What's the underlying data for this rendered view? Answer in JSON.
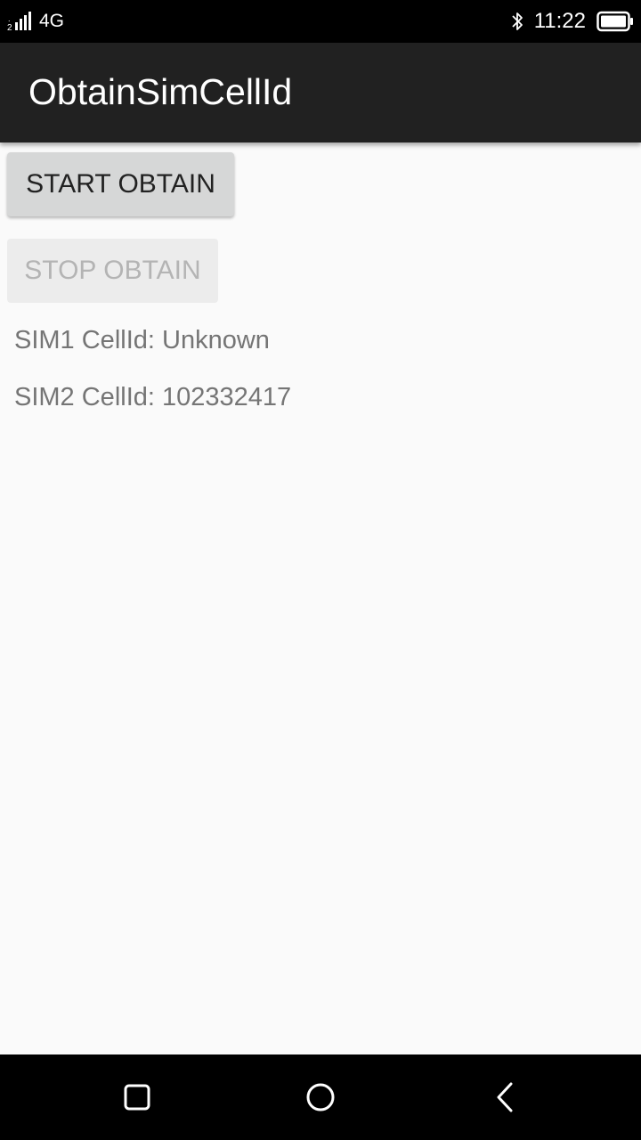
{
  "status_bar": {
    "sim_slot": "2",
    "network_type": "4G",
    "time": "11:22",
    "icons": [
      "signal-icon",
      "bluetooth-icon",
      "battery-icon"
    ]
  },
  "app_bar": {
    "title": "ObtainSimCellId"
  },
  "buttons": {
    "start_label": "START OBTAIN",
    "stop_label": "STOP OBTAIN"
  },
  "info": {
    "sim1": "SIM1 CellId: Unknown",
    "sim2": "SIM2 CellId: 102332417"
  },
  "nav_bar": {
    "icons": [
      "recents-icon",
      "home-icon",
      "back-icon"
    ]
  },
  "colors": {
    "status_bar_bg": "#000000",
    "app_bar_bg": "#212121",
    "page_bg": "#fafafa",
    "start_button_bg": "#d6d7d7",
    "stop_button_bg_disabled": "#ececec",
    "info_text": "#757575"
  }
}
